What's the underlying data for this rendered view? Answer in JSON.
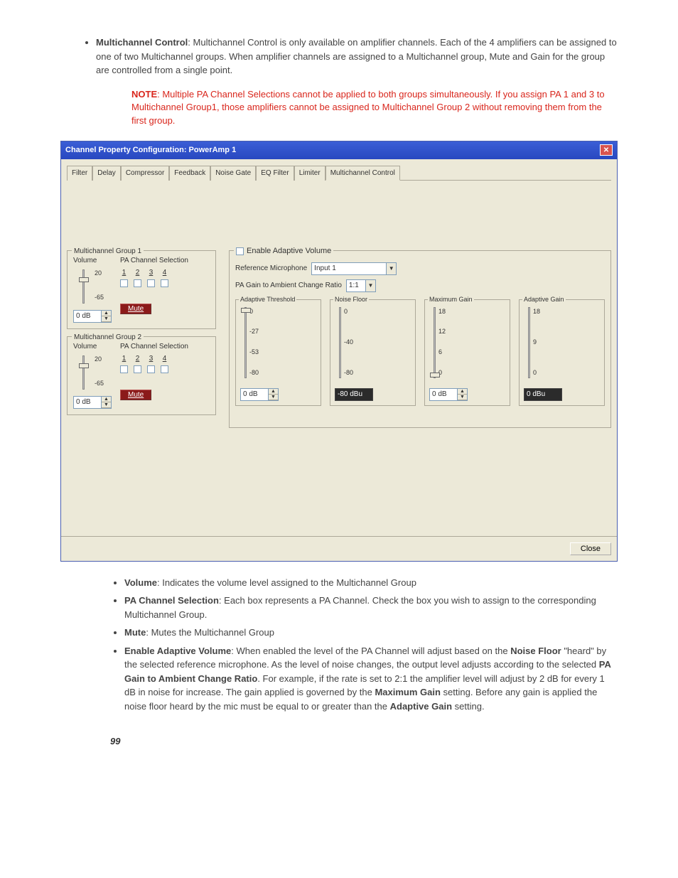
{
  "intro": {
    "label": "Multichannel Control",
    "text": ": Multichannel Control is only available on amplifier channels. Each of the 4 amplifiers can be assigned to one of two Multichannel groups. When amplifier channels are assigned to a Multichannel group, Mute and Gain for the group are controlled from a single point."
  },
  "note": {
    "label": "NOTE",
    "text": ": Multiple PA Channel Selections cannot be applied to both groups simultaneously. If you assign PA 1 and 3 to Multichannel Group1, those amplifiers cannot be assigned to Multichannel Group 2 without removing them from the first group."
  },
  "dialog": {
    "title": "Channel Property Configuration: PowerAmp 1",
    "tabs": [
      "Filter",
      "Delay",
      "Compressor",
      "Feedback",
      "Noise Gate",
      "EQ Filter",
      "Limiter",
      "Multichannel Control"
    ],
    "active_tab": "Multichannel Control",
    "group1": {
      "title": "Multichannel Group 1",
      "volume_label": "Volume",
      "top_tick": "20",
      "bot_tick": "-65",
      "value": "0 dB",
      "pa_label": "PA Channel Selection",
      "channels": [
        "1",
        "2",
        "3",
        "4"
      ],
      "mute": "Mute"
    },
    "group2": {
      "title": "Multichannel Group 2",
      "volume_label": "Volume",
      "top_tick": "20",
      "bot_tick": "-65",
      "value": "0 dB",
      "pa_label": "PA Channel Selection",
      "channels": [
        "1",
        "2",
        "3",
        "4"
      ],
      "mute": "Mute"
    },
    "eav": {
      "title": "Enable Adaptive Volume",
      "ref_mic_label": "Reference Microphone",
      "ref_mic_value": "Input 1",
      "ratio_label": "PA Gain to Ambient Change Ratio",
      "ratio_value": "1:1",
      "adaptive_threshold": {
        "title": "Adaptive Threshold",
        "ticks": [
          "0",
          "-27",
          "-53",
          "-80"
        ],
        "value": "0 dB"
      },
      "noise_floor": {
        "title": "Noise Floor",
        "ticks": [
          "0",
          "-40",
          "-80"
        ],
        "value": "-80 dBu"
      },
      "max_gain": {
        "title": "Maximum Gain",
        "ticks": [
          "18",
          "12",
          "6",
          "0"
        ],
        "value": "0 dB"
      },
      "adaptive_gain": {
        "title": "Adaptive Gain",
        "ticks": [
          "18",
          "9",
          "0"
        ],
        "value": "0 dBu"
      }
    },
    "close_btn": "Close"
  },
  "desc": {
    "volume": {
      "label": "Volume",
      "text": ": Indicates the volume level assigned to the Multichannel Group"
    },
    "pa": {
      "label": "PA Channel Selection",
      "text": ": Each box represents a PA Channel. Check the box you wish to assign to the corresponding Multichannel Group."
    },
    "mute": {
      "label": "Mute",
      "text": ": Mutes the Multichannel Group"
    },
    "eav": {
      "label": "Enable Adaptive Volume",
      "part1": ": When enabled the level of the PA Channel will adjust based on the ",
      "nf": "Noise Floor",
      "part2": " \"heard\" by the selected reference microphone. As the level of noise changes, the output level adjusts according to the selected ",
      "ratio": "PA Gain to Ambient Change Ratio",
      "part3": ". For example, if the rate is set to 2:1 the amplifier level will adjust by 2 dB for every 1 dB in noise for increase. The gain applied is governed by the ",
      "mg": "Maximum Gain",
      "part4": " setting. Before any gain is applied the noise floor heard by the mic must be equal to or greater than the ",
      "ag": "Adaptive Gain",
      "part5": " setting."
    }
  },
  "page_number": "99"
}
